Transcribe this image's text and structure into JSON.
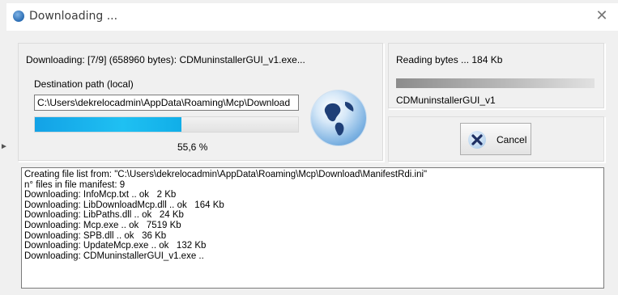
{
  "window": {
    "title": "Downloading ...",
    "close_glyph": "✕"
  },
  "progress": {
    "status_text": "Downloading: [7/9] (658960 bytes): CDMuninstallerGUI_v1.exe...",
    "destination_label": "Destination path (local)",
    "destination_path": "C:\\Users\\dekrelocadmin\\AppData\\Roaming\\Mcp\\Download",
    "percent_text": "55,6 %",
    "fraction": 0.556
  },
  "reading": {
    "status_text": "Reading bytes ... 184 Kb",
    "file_name": "CDMuninstallerGUI_v1"
  },
  "cancel": {
    "label": "Cancel"
  },
  "log": {
    "lines": [
      "Creating file list from: \"C:\\Users\\dekrelocadmin\\AppData\\Roaming\\Mcp\\Download\\ManifestRdi.ini\"",
      "n° files in file manifest: 9",
      "Downloading: InfoMcp.txt .. ok   2 Kb",
      "Downloading: LibDownloadMcp.dll .. ok   164 Kb",
      "Downloading: LibPaths.dll .. ok   24 Kb",
      "Downloading: Mcp.exe .. ok   7519 Kb",
      "Downloading: SPB.dll .. ok   36 Kb",
      "Downloading: UpdateMcp.exe .. ok   132 Kb",
      "Downloading: CDMuninstallerGUI_v1.exe .."
    ]
  },
  "colors": {
    "progress_fill": "#1fb6ef",
    "background": "#f0f0f0"
  },
  "icons": {
    "title": "globe-icon",
    "globe": "globe-icon",
    "cancel": "cancel-x-icon"
  }
}
